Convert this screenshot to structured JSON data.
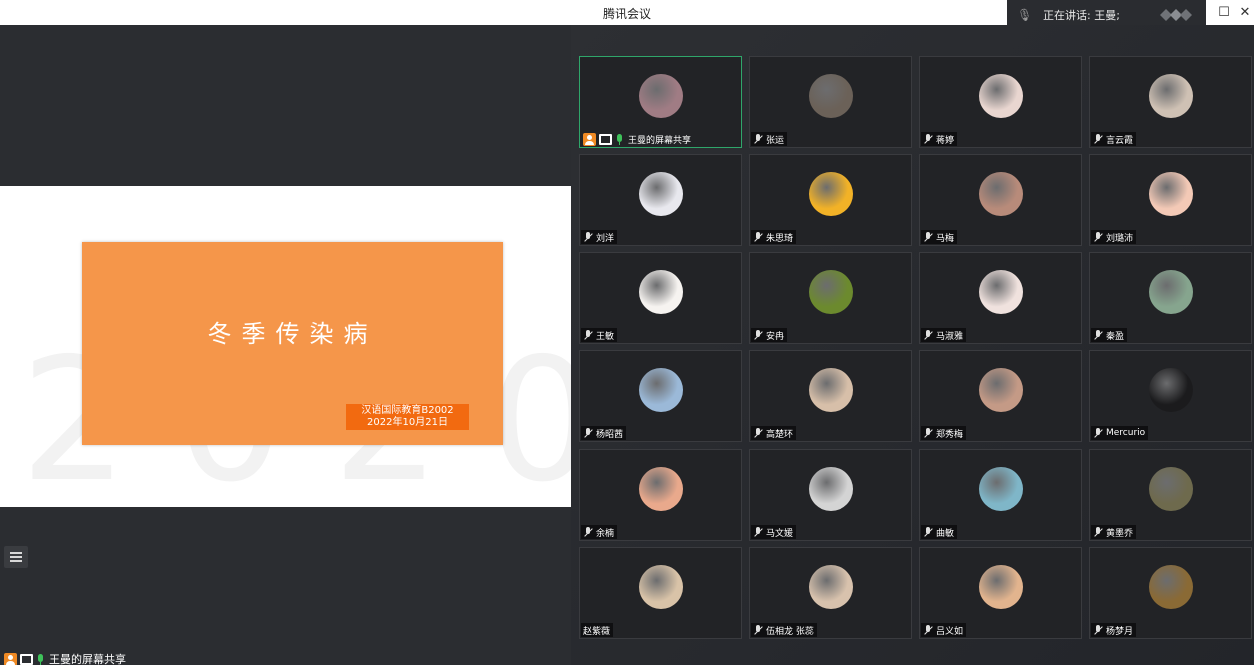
{
  "window": {
    "title": "腾讯会议"
  },
  "speaking": {
    "label": "正在讲话: 王曼;"
  },
  "share": {
    "slide_title": "冬季传染病",
    "slide_line1": "汉语国际教育B2002",
    "slide_line2": "2022年10月21日",
    "status_label": "王曼的屏幕共享"
  },
  "colors": {
    "accent": "#f5964a",
    "active_border": "#2fa66a",
    "mic_on": "#3ec15a"
  },
  "participants": [
    {
      "name": "王曼的屏幕共享",
      "avatar_color": "#a07c84",
      "status": "sharing",
      "active": true
    },
    {
      "name": "张运",
      "avatar_color": "#6b6158",
      "status": "muted"
    },
    {
      "name": "蒋婷",
      "avatar_color": "#e9d6d0",
      "status": "muted"
    },
    {
      "name": "言云霞",
      "avatar_color": "#cfc1b4",
      "status": "muted"
    },
    {
      "name": "刘洋",
      "avatar_color": "#e8e8ee",
      "status": "muted"
    },
    {
      "name": "朱思琦",
      "avatar_color": "#f2b227",
      "status": "muted"
    },
    {
      "name": "马梅",
      "avatar_color": "#b88b7a",
      "status": "muted"
    },
    {
      "name": "刘璐沛",
      "avatar_color": "#f3c9b6",
      "status": "muted"
    },
    {
      "name": "王敏",
      "avatar_color": "#f6f3f0",
      "status": "muted"
    },
    {
      "name": "安冉",
      "avatar_color": "#6c8a2e",
      "status": "muted"
    },
    {
      "name": "马淑雅",
      "avatar_color": "#f0e2de",
      "status": "muted"
    },
    {
      "name": "秦盈",
      "avatar_color": "#86a58e",
      "status": "muted"
    },
    {
      "name": "杨昭茜",
      "avatar_color": "#9bb9d8",
      "status": "muted"
    },
    {
      "name": "高楚环",
      "avatar_color": "#d7bfa9",
      "status": "muted"
    },
    {
      "name": "郑秀梅",
      "avatar_color": "#c49a86",
      "status": "muted"
    },
    {
      "name": "Mercurio",
      "avatar_color": "#1b1b1d",
      "status": "muted"
    },
    {
      "name": "余楠",
      "avatar_color": "#e9a98c",
      "status": "muted"
    },
    {
      "name": "马文媛",
      "avatar_color": "#d4d4d4",
      "status": "muted"
    },
    {
      "name": "曲敏",
      "avatar_color": "#7fb6c8",
      "status": "muted"
    },
    {
      "name": "黄墨乔",
      "avatar_color": "#6e6a4d",
      "status": "muted"
    },
    {
      "name": "赵紫薇",
      "avatar_color": "#d9c3a8",
      "status": "none"
    },
    {
      "name": "伍相龙 张蕊",
      "avatar_color": "#d8c2ad",
      "status": "muted"
    },
    {
      "name": "吕义如",
      "avatar_color": "#e2b48e",
      "status": "muted"
    },
    {
      "name": "杨梦月",
      "avatar_color": "#8a6a35",
      "status": "muted"
    }
  ]
}
